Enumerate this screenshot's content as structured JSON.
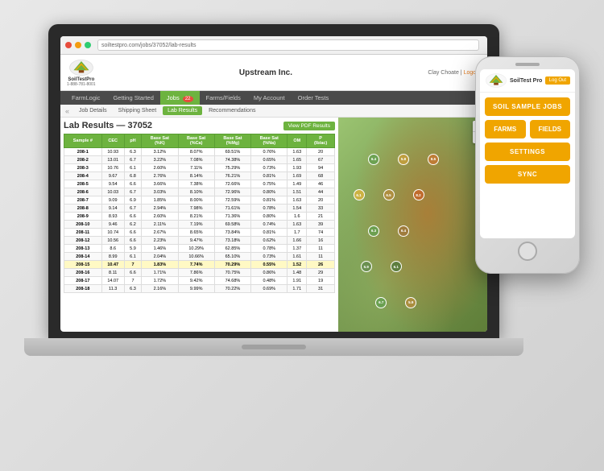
{
  "app": {
    "title": "Upstream Inc.",
    "user": "Clay Choate",
    "logout": "Logout",
    "phone": "1-888-781-8001"
  },
  "nav": {
    "items": [
      {
        "label": "FarmLogic",
        "active": false
      },
      {
        "label": "Getting Started",
        "active": false
      },
      {
        "label": "Jobs",
        "active": true
      },
      {
        "label": "Farms/Fields",
        "active": false
      },
      {
        "label": "My Account",
        "active": false
      },
      {
        "label": "Order Tests",
        "active": false
      }
    ],
    "badge": "22"
  },
  "subnav": {
    "back": "«",
    "items": [
      {
        "label": "Job Details",
        "active": false
      },
      {
        "label": "Shipping Sheet",
        "active": false
      },
      {
        "label": "Lab Results",
        "active": true
      },
      {
        "label": "Recommendations",
        "active": false
      }
    ]
  },
  "page": {
    "title": "Lab Results — 37052",
    "pdf_btn": "View PDF Results"
  },
  "table": {
    "headers": [
      "Sample #",
      "CEC",
      "pH",
      "Base Sat (%K)",
      "Base Sat (%Ca)",
      "Base Sat (%Mg)",
      "Base Sat (%Na)",
      "OM",
      "P (lb/ac)"
    ],
    "rows": [
      {
        "sample": "208-1",
        "cec": "10.93",
        "ph": "6.3",
        "bsk": "3.12%",
        "bsca": "8.07%",
        "bsmg": "69.51%",
        "bsna": "0.76%",
        "om": "1.63",
        "p": "20",
        "highlight": false
      },
      {
        "sample": "208-2",
        "cec": "13.01",
        "ph": "6.7",
        "bsk": "3.22%",
        "bsca": "7.08%",
        "bsmg": "74.38%",
        "bsna": "0.65%",
        "om": "1.65",
        "p": "67",
        "highlight": false
      },
      {
        "sample": "208-3",
        "cec": "10.76",
        "ph": "6.1",
        "bsk": "2.60%",
        "bsca": "7.11%",
        "bsmg": "75.29%",
        "bsna": "0.73%",
        "om": "1.93",
        "p": "94",
        "highlight": false
      },
      {
        "sample": "208-4",
        "cec": "9.67",
        "ph": "6.8",
        "bsk": "2.76%",
        "bsca": "8.14%",
        "bsmg": "76.21%",
        "bsna": "0.81%",
        "om": "1.69",
        "p": "68",
        "highlight": false
      },
      {
        "sample": "208-5",
        "cec": "9.54",
        "ph": "6.6",
        "bsk": "3.66%",
        "bsca": "7.38%",
        "bsmg": "72.66%",
        "bsna": "0.75%",
        "om": "1.49",
        "p": "46",
        "highlight": false
      },
      {
        "sample": "208-6",
        "cec": "10.03",
        "ph": "6.7",
        "bsk": "3.03%",
        "bsca": "8.10%",
        "bsmg": "72.96%",
        "bsna": "0.80%",
        "om": "1.51",
        "p": "44",
        "highlight": false
      },
      {
        "sample": "208-7",
        "cec": "9.09",
        "ph": "6.9",
        "bsk": "1.85%",
        "bsca": "8.00%",
        "bsmg": "72.59%",
        "bsna": "0.81%",
        "om": "1.63",
        "p": "20",
        "highlight": false
      },
      {
        "sample": "208-8",
        "cec": "9.14",
        "ph": "6.7",
        "bsk": "2.94%",
        "bsca": "7.98%",
        "bsmg": "71.61%",
        "bsna": "0.78%",
        "om": "1.54",
        "p": "33",
        "highlight": false
      },
      {
        "sample": "208-9",
        "cec": "8.93",
        "ph": "6.6",
        "bsk": "2.60%",
        "bsca": "8.21%",
        "bsmg": "71.36%",
        "bsna": "0.80%",
        "om": "1.6",
        "p": "21",
        "highlight": false
      },
      {
        "sample": "208-10",
        "cec": "9.46",
        "ph": "6.2",
        "bsk": "2.11%",
        "bsca": "7.19%",
        "bsmg": "69.58%",
        "bsna": "0.74%",
        "om": "1.63",
        "p": "39",
        "highlight": false
      },
      {
        "sample": "208-11",
        "cec": "10.74",
        "ph": "6.6",
        "bsk": "2.67%",
        "bsca": "8.65%",
        "bsmg": "73.84%",
        "bsna": "0.81%",
        "om": "1.7",
        "p": "74",
        "highlight": false
      },
      {
        "sample": "208-12",
        "cec": "10.56",
        "ph": "6.6",
        "bsk": "2.23%",
        "bsca": "9.47%",
        "bsmg": "73.18%",
        "bsna": "0.62%",
        "om": "1.66",
        "p": "16",
        "highlight": false
      },
      {
        "sample": "208-13",
        "cec": "8.6",
        "ph": "5.9",
        "bsk": "1.46%",
        "bsca": "10.29%",
        "bsmg": "62.85%",
        "bsna": "0.78%",
        "om": "1.37",
        "p": "11",
        "highlight": false
      },
      {
        "sample": "208-14",
        "cec": "8.99",
        "ph": "6.1",
        "bsk": "2.04%",
        "bsca": "10.66%",
        "bsmg": "65.10%",
        "bsna": "0.73%",
        "om": "1.61",
        "p": "11",
        "highlight": false
      },
      {
        "sample": "208-15",
        "cec": "10.47",
        "ph": "7",
        "bsk": "1.83%",
        "bsca": "7.74%",
        "bsmg": "70.29%",
        "bsna": "0.55%",
        "om": "1.52",
        "p": "26",
        "highlight": true
      },
      {
        "sample": "208-16",
        "cec": "8.11",
        "ph": "6.6",
        "bsk": "1.71%",
        "bsca": "7.86%",
        "bsmg": "70.75%",
        "bsna": "0.86%",
        "om": "1.48",
        "p": "29",
        "highlight": false
      },
      {
        "sample": "208-17",
        "cec": "14.07",
        "ph": "7",
        "bsk": "1.72%",
        "bsca": "9.42%",
        "bsmg": "74.68%",
        "bsna": "0.48%",
        "om": "1.91",
        "p": "19",
        "highlight": false
      },
      {
        "sample": "208-18",
        "cec": "11.3",
        "ph": "6.3",
        "bsk": "2.16%",
        "bsca": "9.99%",
        "bsmg": "70.22%",
        "bsna": "0.69%",
        "om": "1.71",
        "p": "31",
        "highlight": false
      }
    ]
  },
  "phone": {
    "logout_label": "Log Out",
    "logo_text": "SoilTest Pro",
    "menu": {
      "soil_sample_jobs": "SOIL SAMPLE JOBS",
      "farms": "FARMS",
      "fields": "FIELDS",
      "settings": "SETTINGS",
      "sync": "SYNC"
    }
  },
  "map": {
    "zoom_in": "+",
    "zoom_out": "−"
  }
}
